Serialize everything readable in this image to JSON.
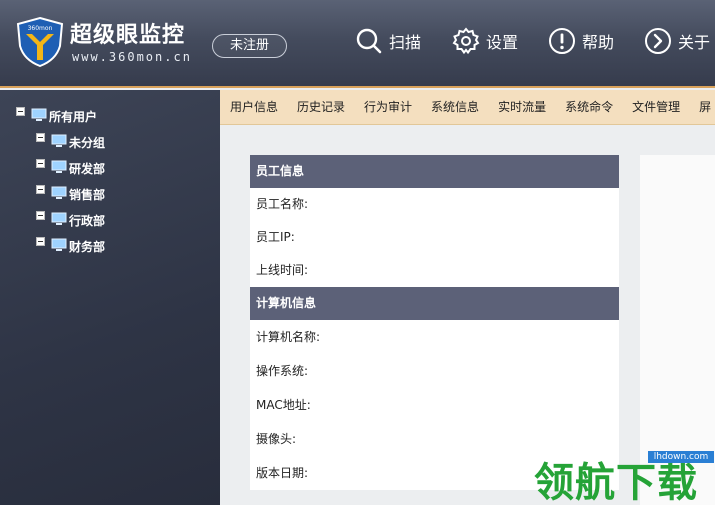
{
  "app": {
    "logo_badge": "360mon",
    "title": "超级眼监控",
    "subtitle": "www.360mon.cn",
    "register_label": "未注册"
  },
  "top_nav": [
    {
      "label": "扫描",
      "icon": "search-icon"
    },
    {
      "label": "设置",
      "icon": "gear-icon"
    },
    {
      "label": "帮助",
      "icon": "help-icon"
    },
    {
      "label": "关于",
      "icon": "chevron-right-icon"
    }
  ],
  "tree": {
    "root": "所有用户",
    "children": [
      "未分组",
      "研发部",
      "销售部",
      "行政部",
      "财务部"
    ]
  },
  "tabs": [
    "用户信息",
    "历史记录",
    "行为审计",
    "系统信息",
    "实时流量",
    "系统命令",
    "文件管理",
    "屏"
  ],
  "employee_section": {
    "heading": "员工信息",
    "fields": [
      "员工名称:",
      "员工IP:",
      "上线时间:"
    ]
  },
  "computer_section": {
    "heading": "计算机信息",
    "fields": [
      "计算机名称:",
      "操作系统:",
      "MAC地址:",
      "摄像头:",
      "版本日期:"
    ]
  },
  "watermark": {
    "url": "lhdown.com",
    "text": "领航下载"
  },
  "colors": {
    "accent_border": "#d9a25b",
    "tab_bar": "#f4dfbf",
    "section_header": "#5c6178",
    "watermark_green": "#25a337"
  }
}
